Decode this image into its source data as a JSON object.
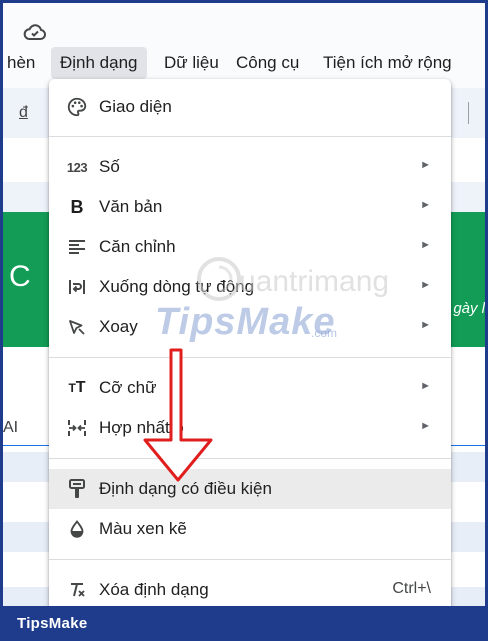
{
  "menubar": {
    "items": [
      "hèn",
      "Định dạng",
      "Dữ liệu",
      "Công cụ",
      "Tiện ích mở rộng"
    ],
    "active_index": 1
  },
  "toolbar": {
    "glyph": "đ"
  },
  "sheet": {
    "band_letter": "C",
    "band_right_text": "gày l",
    "row_label": "AI"
  },
  "dropdown": {
    "items": [
      {
        "icon": "palette-icon",
        "label": "Giao diện",
        "submenu": false
      },
      {
        "icon": "number-123-icon",
        "label": "Số",
        "submenu": true
      },
      {
        "icon": "bold-b-icon",
        "label": "Văn bản",
        "submenu": true
      },
      {
        "icon": "align-left-icon",
        "label": "Căn chỉnh",
        "submenu": true
      },
      {
        "icon": "wrap-text-icon",
        "label": "Xuống dòng tự động",
        "submenu": true
      },
      {
        "icon": "rotate-text-icon",
        "label": "Xoay",
        "submenu": true
      },
      {
        "icon": "font-size-icon",
        "label": "Cỡ chữ",
        "submenu": true
      },
      {
        "icon": "merge-cells-icon",
        "label": "Hợp nhất ô",
        "submenu": true
      },
      {
        "icon": "paint-format-icon",
        "label": "Định dạng có điều kiện",
        "submenu": false,
        "highlighted": true
      },
      {
        "icon": "color-drop-icon",
        "label": "Màu xen kẽ",
        "submenu": false
      },
      {
        "icon": "clear-format-icon",
        "label": "Xóa định dạng",
        "submenu": false,
        "shortcut": "Ctrl+\\"
      }
    ],
    "submenu_arrow": "►"
  },
  "watermark": {
    "brand": "TipsMake",
    "domain": ".com",
    "logo_text": "uantrimang"
  },
  "footer": {
    "brand": "TipsMake"
  },
  "colors": {
    "accent_green": "#129c55",
    "footer_blue": "#1f3c8c",
    "arrow_red": "#e01e1e",
    "highlight": "#ebebeb"
  }
}
